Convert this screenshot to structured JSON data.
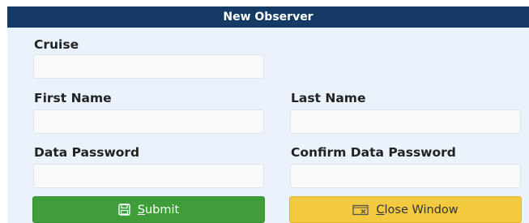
{
  "window": {
    "title": "New Observer"
  },
  "form": {
    "cruise": {
      "label": "Cruise",
      "value": ""
    },
    "first_name": {
      "label": "First Name",
      "value": ""
    },
    "last_name": {
      "label": "Last Name",
      "value": ""
    },
    "data_password": {
      "label": "Data Password",
      "value": ""
    },
    "confirm_data_password": {
      "label": "Confirm Data Password",
      "value": ""
    }
  },
  "buttons": {
    "submit": {
      "mnemonic": "S",
      "rest": "ubmit",
      "icon": "save-icon"
    },
    "close_window": {
      "mnemonic": "C",
      "rest": "lose Window",
      "icon": "close-window-icon"
    }
  },
  "colors": {
    "titlebar": "#143a66",
    "background": "#eaf3fb",
    "submit": "#3f9e3a",
    "close": "#f2c93f"
  }
}
